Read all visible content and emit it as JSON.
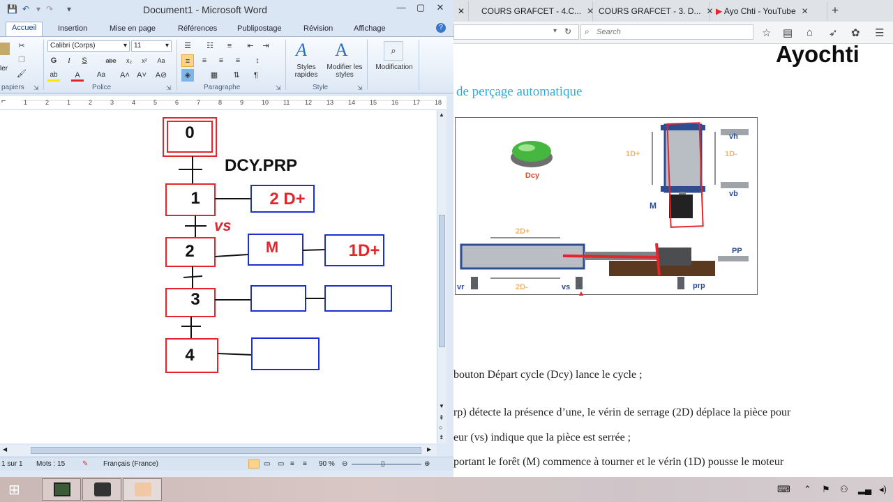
{
  "word": {
    "title": "Document1 - Microsoft Word",
    "tabs": [
      "Accueil",
      "Insertion",
      "Mise en page",
      "Références",
      "Publipostage",
      "Révision",
      "Affichage"
    ],
    "font_name": "Calibri (Corps)",
    "font_size": "11",
    "groups": {
      "clipboard": "papiers",
      "font": "Police",
      "paragraph": "Paragraphe",
      "style": "Style"
    },
    "buttons": {
      "clipboard_partial": "ler",
      "styles_rapides": "Styles rapides",
      "modifier_styles": "Modifier les styles",
      "modification": "Modification"
    },
    "ruler_numbers": [
      "1",
      "2",
      "1",
      "2",
      "3",
      "4",
      "5",
      "6",
      "7",
      "8",
      "9",
      "10",
      "11",
      "12",
      "13",
      "14",
      "15",
      "16",
      "17",
      "18"
    ],
    "status": {
      "page": "1 sur 1",
      "words": "Mots : 15",
      "language": "Français (France)",
      "zoom": "90 %"
    }
  },
  "grafcet": {
    "steps": [
      "0",
      "1",
      "2",
      "3",
      "4"
    ],
    "transition0": "DCY.PRP",
    "transition1": "vs",
    "actions": {
      "step1": "2 D+",
      "step2a": "M",
      "step2b": "1D+"
    }
  },
  "browser": {
    "tabs": [
      "COURS GRAFCET - 4.C...",
      "COURS GRAFCET - 3. D...",
      "Ayo Chti - YouTube"
    ],
    "search_placeholder": "Search",
    "watermark": "Ayochti",
    "heading": "de perçage automatique",
    "diagram_labels": {
      "dcy": "Dcy",
      "vh": "vh",
      "vb": "vb",
      "d1plus": "1D+",
      "d1minus": "1D-",
      "m": "M",
      "d2plus": "2D+",
      "d2minus": "2D-",
      "pp": "PP",
      "prp": "prp",
      "vs": "vs",
      "vr": "vr"
    },
    "text_lines": [
      "bouton Départ cycle (Dcy) lance le cycle ;",
      "rp) détecte la présence d’une, le vérin de serrage (2D) déplace la pièce pour",
      "eur (vs) indique que la pièce est serrée ;",
      "portant le forêt (M) commence à tourner et le vérin (1D) pousse le moteur"
    ]
  },
  "colors": {
    "step_red": "#e4262c",
    "action_blue": "#1c2fd0",
    "heading_blue": "#31a9d8",
    "word_blue": "#2b579a"
  }
}
